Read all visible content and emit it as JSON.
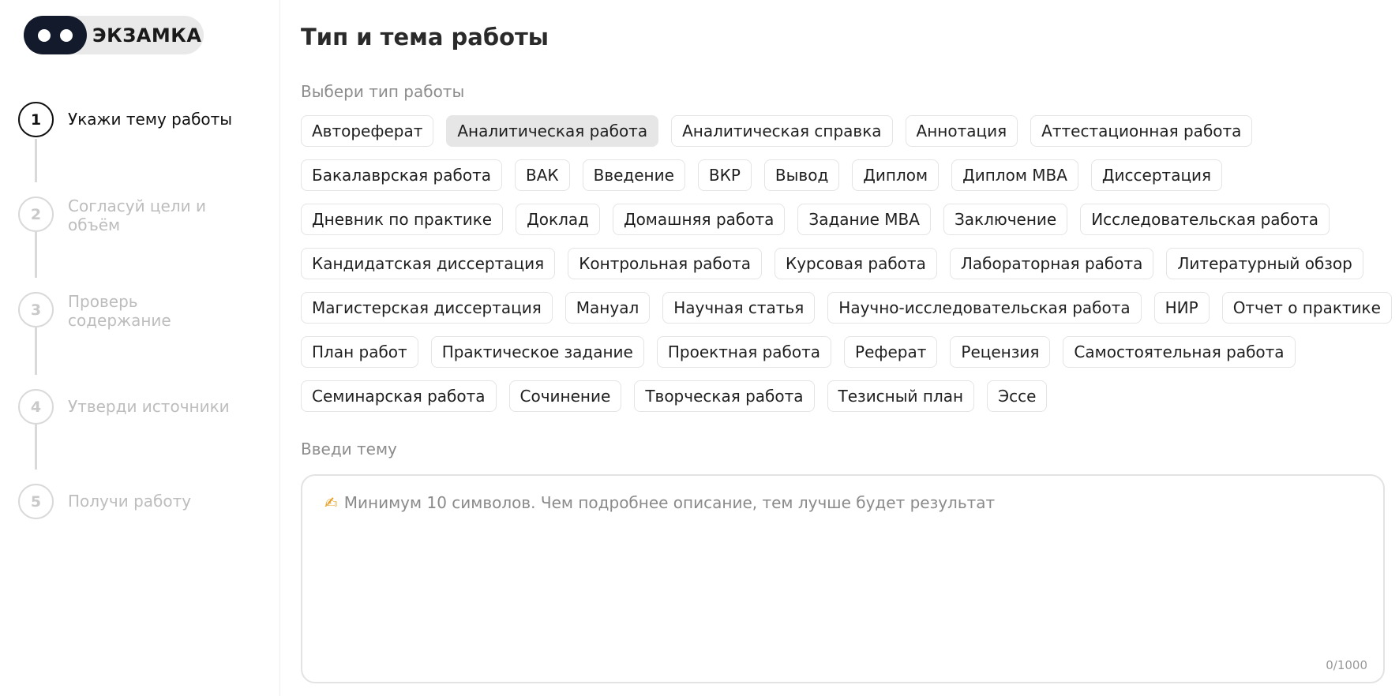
{
  "logo": {
    "text": "ЭКЗАМКА"
  },
  "steps": [
    {
      "number": "1",
      "label": "Укажи тему работы"
    },
    {
      "number": "2",
      "label": "Согласуй цели и объём"
    },
    {
      "number": "3",
      "label": "Проверь содержание"
    },
    {
      "number": "4",
      "label": "Утверди источники"
    },
    {
      "number": "5",
      "label": "Получи работу"
    }
  ],
  "main": {
    "title": "Тип и тема работы",
    "type_label": "Выбери тип работы",
    "topic_label": "Введи тему",
    "topic_placeholder": "Минимум 10 символов. Чем подробнее описание, тем лучше будет результат",
    "counter": "0/1000"
  },
  "work_types": [
    [
      "Автореферат",
      "Аналитическая работа",
      "Аналитическая справка",
      "Аннотация",
      "Аттестационная работа"
    ],
    [
      "Бакалаврская работа",
      "ВАК",
      "Введение",
      "ВКР",
      "Вывод",
      "Диплом",
      "Диплом MBA",
      "Диссертация"
    ],
    [
      "Дневник по практике",
      "Доклад",
      "Домашняя работа",
      "Задание MBA",
      "Заключение",
      "Исследовательская работа"
    ],
    [
      "Кандидатская диссертация",
      "Контрольная работа",
      "Курсовая работа",
      "Лабораторная работа",
      "Литературный обзор"
    ],
    [
      "Магистерская диссертация",
      "Мануал",
      "Научная статья",
      "Научно-исследовательская работа",
      "НИР",
      "Отчет о практике"
    ],
    [
      "План работ",
      "Практическое задание",
      "Проектная работа",
      "Реферат",
      "Рецензия",
      "Самостоятельная работа"
    ],
    [
      "Семинарская работа",
      "Сочинение",
      "Творческая работа",
      "Тезисный план",
      "Эссе"
    ]
  ],
  "selected_type": "Аналитическая работа",
  "colors": {
    "logo_dark": "#121a2b",
    "selected_chip": "#e6e6e6",
    "muted_text": "#8c8c8c"
  }
}
